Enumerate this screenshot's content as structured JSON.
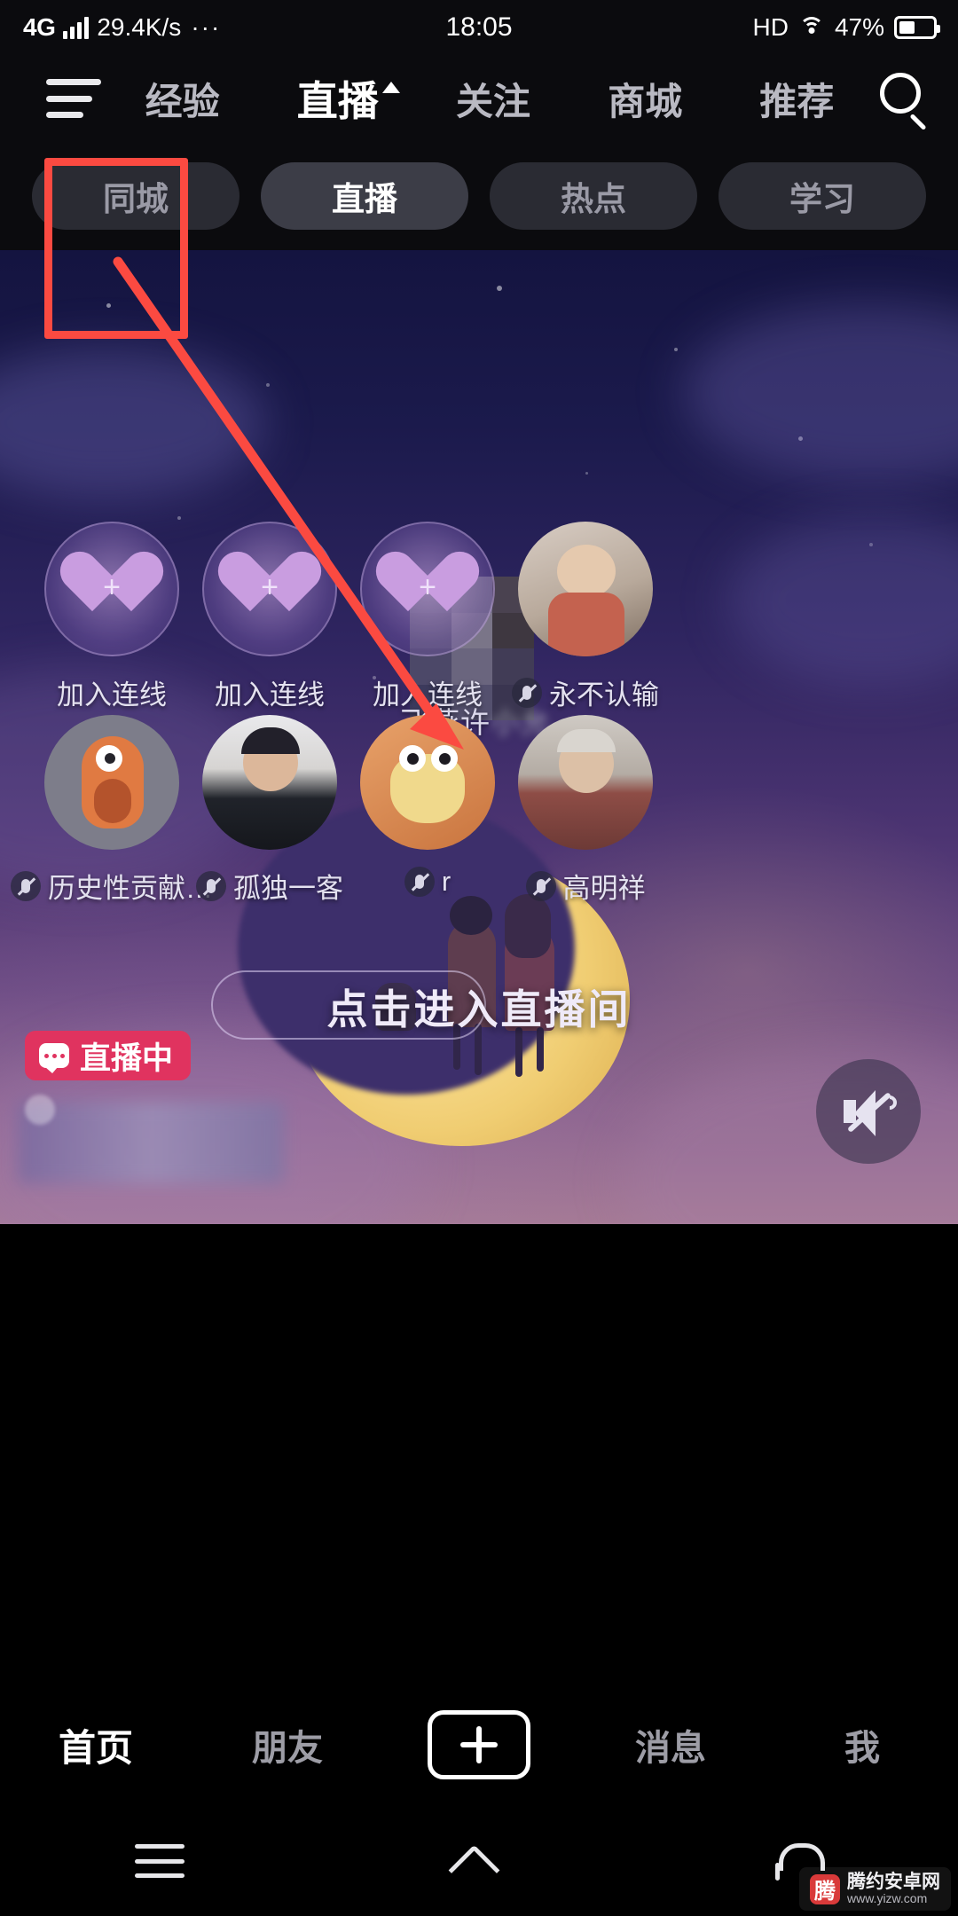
{
  "status_bar": {
    "network": "4G",
    "speed": "29.4K/s",
    "overflow": "···",
    "time": "18:05",
    "hd": "HD",
    "battery_percent": "47%",
    "wifi_icon": "wifi-icon",
    "signal_icon": "signal-bars-icon",
    "battery_icon": "battery-icon"
  },
  "top_nav": {
    "menu_icon": "hamburger-menu-icon",
    "search_icon": "search-icon",
    "items": [
      {
        "label": "经验",
        "active": false
      },
      {
        "label": "直播",
        "active": true
      },
      {
        "label": "关注",
        "active": false
      },
      {
        "label": "商城",
        "active": false
      },
      {
        "label": "推荐",
        "active": false
      }
    ]
  },
  "sub_tabs": [
    {
      "label": "同城",
      "active": false
    },
    {
      "label": "直播",
      "active": true
    },
    {
      "label": "热点",
      "active": false
    },
    {
      "label": "学习",
      "active": false
    }
  ],
  "live_room": {
    "host_name_visible": "飞燕许",
    "host_name_blurred": "小允",
    "enter_hint": "点击进入直播间",
    "live_badge": "直播中",
    "mute_icon": "speaker-muted-icon",
    "seat_row_1": [
      {
        "label": "加入连线",
        "type": "join",
        "muted": false
      },
      {
        "label": "加入连线",
        "type": "join",
        "muted": false
      },
      {
        "label": "加入连线",
        "type": "join",
        "muted": false
      },
      {
        "label": "永不认输",
        "type": "user",
        "muted": true
      }
    ],
    "seat_row_2": [
      {
        "label": "历史性贡献…",
        "type": "user",
        "muted": true
      },
      {
        "label": "孤独一客",
        "type": "user",
        "muted": true
      },
      {
        "label": "r",
        "type": "user",
        "muted": true
      },
      {
        "label": "高明祥",
        "type": "user",
        "muted": true
      }
    ]
  },
  "bottom_tabs": [
    {
      "label": "首页",
      "active": true
    },
    {
      "label": "朋友",
      "active": false
    },
    {
      "label": "+",
      "active": false,
      "icon": "add-post-icon"
    },
    {
      "label": "消息",
      "active": false
    },
    {
      "label": "我",
      "active": false
    }
  ],
  "system_nav": {
    "menu_icon": "android-menu-icon",
    "home_icon": "android-home-icon",
    "back_icon": "android-back-icon"
  },
  "annotation": {
    "color": "#fb4a41",
    "highlight_target": "同城",
    "arrow": "points from 同城 pill to live room center"
  },
  "watermark": {
    "logo": "腾",
    "title": "腾约安卓网",
    "sub": "www.yizw.com"
  }
}
